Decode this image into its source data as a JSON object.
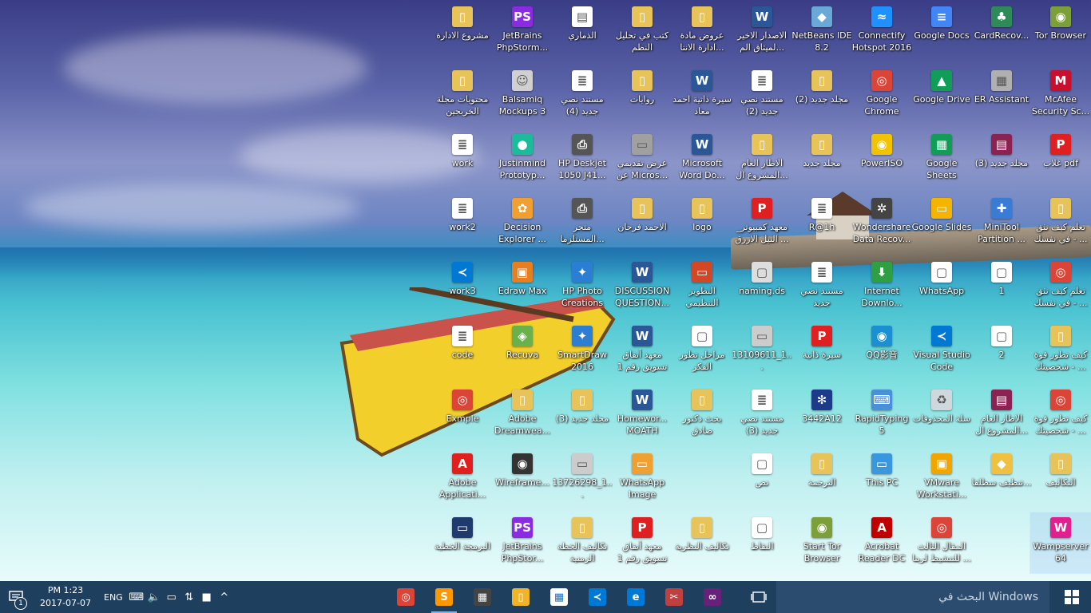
{
  "desktop": {
    "icons": [
      {
        "label": "مشروع الادارة",
        "icon": "folder-icon",
        "color": "#e8c35a",
        "glyph": "▯"
      },
      {
        "label": "JetBrains PhpStorm...",
        "icon": "phpstorm-icon",
        "color": "#8a2be2",
        "glyph": "PS"
      },
      {
        "label": "الذماري",
        "icon": "document-icon",
        "color": "#ffffff",
        "glyph": "▤"
      },
      {
        "label": "كتب في تحليل النظم",
        "icon": "folder-icon",
        "color": "#e8c35a",
        "glyph": "▯"
      },
      {
        "label": "عروض مادة ادارة الانتا...",
        "icon": "folder-icon",
        "color": "#e8c35a",
        "glyph": "▯"
      },
      {
        "label": "الاصدار الاخير لميثاق الم...",
        "icon": "word-icon",
        "color": "#2b5797",
        "glyph": "W"
      },
      {
        "label": "NetBeans IDE 8.2",
        "icon": "netbeans-icon",
        "color": "#6aa8d8",
        "glyph": "◆"
      },
      {
        "label": "Connectify Hotspot 2016",
        "icon": "connectify-icon",
        "color": "#1e90ff",
        "glyph": "≈"
      },
      {
        "label": "Google Docs",
        "icon": "google-docs-icon",
        "color": "#4285f4",
        "glyph": "≡"
      },
      {
        "label": "CardRecov...",
        "icon": "cardrecovery-icon",
        "color": "#2e8b57",
        "glyph": "♣"
      },
      {
        "label": "Tor Browser",
        "icon": "tor-browser-icon",
        "color": "#7d9f3a",
        "glyph": "◉"
      },
      {
        "label": "محتويات مجلة الخريجين",
        "icon": "folder-icon",
        "color": "#e8c35a",
        "glyph": "▯"
      },
      {
        "label": "Balsamiq Mockups 3",
        "icon": "balsamiq-icon",
        "color": "#d0d0d0",
        "glyph": "☺"
      },
      {
        "label": "مستند نصي جديد (4)",
        "icon": "text-document-icon",
        "color": "#ffffff",
        "glyph": "≣"
      },
      {
        "label": "روايات",
        "icon": "folder-icon",
        "color": "#e8c35a",
        "glyph": "▯"
      },
      {
        "label": "سيرة ذاتية احمد معاذ",
        "icon": "word-icon",
        "color": "#2b5797",
        "glyph": "W"
      },
      {
        "label": "مستند نصي جديد (2)",
        "icon": "text-document-icon",
        "color": "#ffffff",
        "glyph": "≣"
      },
      {
        "label": "مجلد جديد (2)",
        "icon": "folder-icon",
        "color": "#e8c35a",
        "glyph": "▯"
      },
      {
        "label": "Google Chrome",
        "icon": "chrome-icon",
        "color": "#db4437",
        "glyph": "◎"
      },
      {
        "label": "Google Drive",
        "icon": "google-drive-icon",
        "color": "#0f9d58",
        "glyph": "▲"
      },
      {
        "label": "ER Assistant",
        "icon": "er-assistant-icon",
        "color": "#b0b0b0",
        "glyph": "▦"
      },
      {
        "label": "McAfee Security Sc...",
        "icon": "mcafee-icon",
        "color": "#c8102e",
        "glyph": "M"
      },
      {
        "label": "work",
        "icon": "text-document-icon",
        "color": "#ffffff",
        "glyph": "≣"
      },
      {
        "label": "Justinmind Prototyp...",
        "icon": "justinmind-icon",
        "color": "#1abc9c",
        "glyph": "●"
      },
      {
        "label": "HP Deskjet 1050 J41...",
        "icon": "printer-icon",
        "color": "#555555",
        "glyph": "⎙"
      },
      {
        "label": "عرض تقديمي عن Micros...",
        "icon": "image-icon",
        "color": "#a0a0a0",
        "glyph": "▭"
      },
      {
        "label": "Microsoft Word Do...",
        "icon": "word-icon",
        "color": "#2b5797",
        "glyph": "W"
      },
      {
        "label": "الاطار العام المشروع ال...",
        "icon": "folder-icon",
        "color": "#e8c35a",
        "glyph": "▯"
      },
      {
        "label": "مجلد جديد",
        "icon": "folder-icon",
        "color": "#e8c35a",
        "glyph": "▯"
      },
      {
        "label": "PowerISO",
        "icon": "poweriso-icon",
        "color": "#f2c300",
        "glyph": "◉"
      },
      {
        "label": "Google Sheets",
        "icon": "google-sheets-icon",
        "color": "#0f9d58",
        "glyph": "▦"
      },
      {
        "label": "مجلد جديد (3)",
        "icon": "winrar-icon",
        "color": "#8b2252",
        "glyph": "▤"
      },
      {
        "label": "غلاب pdf",
        "icon": "pdf-icon",
        "color": "#e02020",
        "glyph": "P"
      },
      {
        "label": "work2",
        "icon": "text-document-icon",
        "color": "#ffffff",
        "glyph": "≣"
      },
      {
        "label": "Decision Explorer ...",
        "icon": "decision-explorer-icon",
        "color": "#f0a030",
        "glyph": "✿"
      },
      {
        "label": "متجر المستلزما...",
        "icon": "printer-icon",
        "color": "#555555",
        "glyph": "⎙"
      },
      {
        "label": "الاحمد فرحان",
        "icon": "folder-icon",
        "color": "#e8c35a",
        "glyph": "▯"
      },
      {
        "label": "logo",
        "icon": "folder-icon",
        "color": "#e8c35a",
        "glyph": "▯"
      },
      {
        "label": "معهد كمبيوتر_ النيل الازرق ...",
        "icon": "pdf-icon",
        "color": "#e02020",
        "glyph": "P"
      },
      {
        "label": "R@1h",
        "icon": "text-document-icon",
        "color": "#ffffff",
        "glyph": "≣"
      },
      {
        "label": "Wondershare Data Recov...",
        "icon": "wondershare-icon",
        "color": "#444444",
        "glyph": "✲"
      },
      {
        "label": "Google Slides",
        "icon": "google-slides-icon",
        "color": "#f4b400",
        "glyph": "▭"
      },
      {
        "label": "MiniTool Partition ...",
        "icon": "minitool-icon",
        "color": "#3a7bd5",
        "glyph": "✚"
      },
      {
        "label": "تعلم كيف تثق في نفسك - ...",
        "icon": "folder-icon",
        "color": "#e8c35a",
        "glyph": "▯"
      },
      {
        "label": "work3",
        "icon": "vscode-icon",
        "color": "#0078d4",
        "glyph": "≺"
      },
      {
        "label": "Edraw Max",
        "icon": "edraw-icon",
        "color": "#e67e22",
        "glyph": "▣"
      },
      {
        "label": "HP Photo Creations",
        "icon": "hp-photo-icon",
        "color": "#2a7fd4",
        "glyph": "✦"
      },
      {
        "label": "DISCUSSION QUESTION...",
        "icon": "word-icon",
        "color": "#2b5797",
        "glyph": "W"
      },
      {
        "label": "التطوير التنظيمي",
        "icon": "powerpoint-icon",
        "color": "#d24726",
        "glyph": "▭"
      },
      {
        "label": "naming.ds",
        "icon": "file-icon",
        "color": "#dddddd",
        "glyph": "▢"
      },
      {
        "label": "مستند نصي جديد",
        "icon": "text-document-icon",
        "color": "#ffffff",
        "glyph": "≣"
      },
      {
        "label": "Internet Downlo...",
        "icon": "idm-icon",
        "color": "#2ea043",
        "glyph": "⬇"
      },
      {
        "label": "WhatsApp",
        "icon": "file-icon",
        "color": "#ffffff",
        "glyph": "▢"
      },
      {
        "label": "1",
        "icon": "file-icon",
        "color": "#ffffff",
        "glyph": "▢"
      },
      {
        "label": "تعلم كيف تثق في نفسك - ...",
        "icon": "chrome-icon",
        "color": "#db4437",
        "glyph": "◎"
      },
      {
        "label": "code",
        "icon": "text-document-icon",
        "color": "#ffffff",
        "glyph": "≣"
      },
      {
        "label": "Recuva",
        "icon": "recuva-icon",
        "color": "#6ab04c",
        "glyph": "◈"
      },
      {
        "label": "SmartDraw 2016",
        "icon": "smartdraw-icon",
        "color": "#2d7dd2",
        "glyph": "✦"
      },
      {
        "label": "معهد أنفاق تسويق رقم 1",
        "icon": "word-icon",
        "color": "#2b5797",
        "glyph": "W"
      },
      {
        "label": "مراحل تطور الفكر",
        "icon": "file-icon",
        "color": "#ffffff",
        "glyph": "▢"
      },
      {
        "label": "13109611_1...",
        "icon": "image-icon",
        "color": "#cccccc",
        "glyph": "▭"
      },
      {
        "label": "سيرة ذاتية",
        "icon": "pdf-icon",
        "color": "#e02020",
        "glyph": "P"
      },
      {
        "label": "QQ影音",
        "icon": "qq-player-icon",
        "color": "#1a8fd1",
        "glyph": "◉"
      },
      {
        "label": "Visual Studio Code",
        "icon": "vscode-icon",
        "color": "#0078d4",
        "glyph": "≺"
      },
      {
        "label": "2",
        "icon": "file-icon",
        "color": "#ffffff",
        "glyph": "▢"
      },
      {
        "label": "كيف تطور قوة شخصيتك - ...",
        "icon": "folder-icon",
        "color": "#e8c35a",
        "glyph": "▯"
      },
      {
        "label": "Exmple",
        "icon": "chrome-icon",
        "color": "#db4437",
        "glyph": "◎"
      },
      {
        "label": "Adobe Dreamwea...",
        "icon": "folder-icon",
        "color": "#e8c35a",
        "glyph": "▯"
      },
      {
        "label": "مجلد جديد (3)",
        "icon": "folder-icon",
        "color": "#e8c35a",
        "glyph": "▯"
      },
      {
        "label": "Homewor... MOATH",
        "icon": "word-icon",
        "color": "#2b5797",
        "glyph": "W"
      },
      {
        "label": "بحث دكتور صادق",
        "icon": "folder-icon",
        "color": "#e8c35a",
        "glyph": "▯"
      },
      {
        "label": "مستند نصي جديد (3)",
        "icon": "text-document-icon",
        "color": "#ffffff",
        "glyph": "≣"
      },
      {
        "label": "3442A12",
        "icon": "app-icon",
        "color": "#1e3a8a",
        "glyph": "✻"
      },
      {
        "label": "RapidTyping 5",
        "icon": "rapidtyping-icon",
        "color": "#4a90d9",
        "glyph": "⌨"
      },
      {
        "label": "سلة المحذوفات",
        "icon": "recycle-bin-icon",
        "color": "#cfd8dc",
        "glyph": "♻"
      },
      {
        "label": "الاطار العام المشروع ال...",
        "icon": "winrar-icon",
        "color": "#8b2252",
        "glyph": "▤"
      },
      {
        "label": "كيف تطور قوة شخصيتك - ...",
        "icon": "chrome-icon",
        "color": "#db4437",
        "glyph": "◎"
      },
      {
        "label": "Adobe Applicati...",
        "icon": "adobe-icon",
        "color": "#e0201f",
        "glyph": "A"
      },
      {
        "label": "Wireframe...",
        "icon": "wireframe-icon",
        "color": "#333333",
        "glyph": "◉"
      },
      {
        "label": "13726298_1...",
        "icon": "image-icon",
        "color": "#cccccc",
        "glyph": "▭"
      },
      {
        "label": "WhatsApp Image 2016...",
        "icon": "image-icon",
        "color": "#f0a030",
        "glyph": "▭"
      },
      {
        "label": "نص",
        "icon": "file-icon",
        "color": "#ffffff",
        "glyph": "▢"
      },
      {
        "label": "الترجمة",
        "icon": "folder-icon",
        "color": "#e8c35a",
        "glyph": "▯"
      },
      {
        "label": "This PC",
        "icon": "this-pc-icon",
        "color": "#3a96dd",
        "glyph": "▭"
      },
      {
        "label": "VMware Workstati...",
        "icon": "vmware-icon",
        "color": "#f0a500",
        "glyph": "▣"
      },
      {
        "label": "تنظيف سطلقا...",
        "icon": "shield-icon",
        "color": "#f0c040",
        "glyph": "◆"
      },
      {
        "label": "التكاليف",
        "icon": "folder-icon",
        "color": "#e8c35a",
        "glyph": "▯"
      },
      {
        "label": "البرمجة الخطية",
        "icon": "image-icon",
        "color": "#1e3a6e",
        "glyph": "▭"
      },
      {
        "label": "JetBrains PhpStor...",
        "icon": "phpstorm-icon",
        "color": "#8a2be2",
        "glyph": "PS"
      },
      {
        "label": "تكاليف الخطة الزمنية",
        "icon": "folder-icon",
        "color": "#e8c35a",
        "glyph": "▯"
      },
      {
        "label": "معهد أنفاق تسويق رقم 1",
        "icon": "pdf-icon",
        "color": "#e02020",
        "glyph": "P"
      },
      {
        "label": "تكاليف النظرية",
        "icon": "folder-icon",
        "color": "#e8c35a",
        "glyph": "▯"
      },
      {
        "label": "النقاط",
        "icon": "file-icon",
        "color": "#ffffff",
        "glyph": "▢"
      },
      {
        "label": "Start Tor Browser",
        "icon": "tor-browser-icon",
        "color": "#7d9f3a",
        "glyph": "◉"
      },
      {
        "label": "Acrobat Reader DC",
        "icon": "acrobat-icon",
        "color": "#c00000",
        "glyph": "A"
      },
      {
        "label": "المقال الثالث للتنشيط لربنا ...",
        "icon": "chrome-icon",
        "color": "#db4437",
        "glyph": "◎"
      },
      {
        "label": "Wampserver 64",
        "icon": "wampserver-icon",
        "color": "#e0208f",
        "glyph": "W"
      }
    ]
  },
  "taskbar": {
    "search_placeholder": "البحث في Windows",
    "clock": {
      "time": "PM 1:23",
      "date": "2017-07-07"
    },
    "notification_count": "1",
    "language": "ENG",
    "tray": [
      {
        "name": "keyboard-icon",
        "glyph": "⌨"
      },
      {
        "name": "volume-icon",
        "glyph": "🔈"
      },
      {
        "name": "battery-icon",
        "glyph": "▭"
      },
      {
        "name": "network-icon",
        "glyph": "⇅"
      },
      {
        "name": "tray-app-icon",
        "glyph": "■"
      },
      {
        "name": "show-hidden-icons-chevron-icon",
        "glyph": "^"
      }
    ],
    "pinned_apps": [
      {
        "name": "visual-studio-icon",
        "color": "#68217a",
        "glyph": "∞",
        "active": false
      },
      {
        "name": "snipping-tool-icon",
        "color": "#c04040",
        "glyph": "✂",
        "active": false
      },
      {
        "name": "edge-icon",
        "color": "#0078d7",
        "glyph": "e",
        "active": false
      },
      {
        "name": "vscode-icon",
        "color": "#0078d4",
        "glyph": "≺",
        "active": false
      },
      {
        "name": "store-icon",
        "color": "#ffffff",
        "glyph": "▦",
        "active": false
      },
      {
        "name": "file-explorer-icon",
        "color": "#f0b429",
        "glyph": "▯",
        "active": false
      },
      {
        "name": "calculator-icon",
        "color": "#444444",
        "glyph": "▦",
        "active": false
      },
      {
        "name": "sublime-text-icon",
        "color": "#ff9800",
        "glyph": "S",
        "active": true
      },
      {
        "name": "chrome-icon",
        "color": "#db4437",
        "glyph": "◎",
        "active": false
      }
    ]
  }
}
